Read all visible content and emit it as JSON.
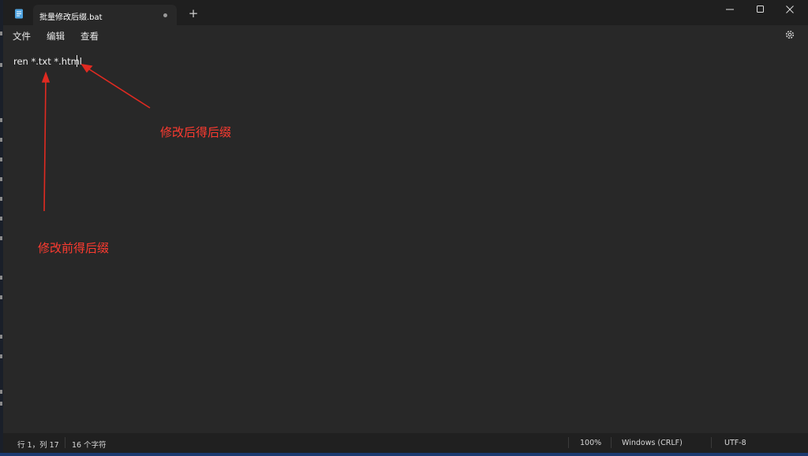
{
  "tab": {
    "title": "批量修改后缀.bat"
  },
  "menu": {
    "file": "文件",
    "edit": "编辑",
    "view": "查看"
  },
  "editor": {
    "content": "ren *.txt *.html"
  },
  "annotations": {
    "after_suffix": "修改后得后缀",
    "before_suffix": "修改前得后缀"
  },
  "status": {
    "position": "行 1，列 17",
    "char_count": "16 个字符",
    "zoom": "100%",
    "line_ending": "Windows (CRLF)",
    "encoding": "UTF-8"
  },
  "colors": {
    "annotation": "#ff3b30",
    "editor_bg": "#282828",
    "titlebar_bg": "#1f1f1f",
    "app_icon": "#4fa3e0"
  },
  "icons": [
    "notepad-icon",
    "unsaved-dot-icon",
    "plus-icon",
    "minimize-icon",
    "maximize-icon",
    "close-icon",
    "gear-icon"
  ]
}
